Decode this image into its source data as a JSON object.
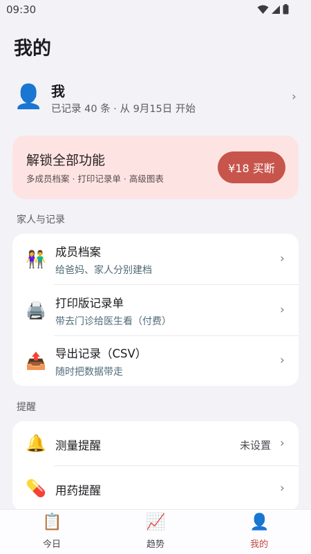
{
  "status_bar": {
    "time": "09:30"
  },
  "page_title": "我的",
  "profile": {
    "name": "我",
    "subtitle": "已记录 40 条 · 从 9月15日 开始"
  },
  "promo": {
    "title": "解锁全部功能",
    "subtitle": "多成员档案 · 打印记录单 · 高级图表",
    "button_label": "¥18 买断",
    "accent_color": "#c7554c"
  },
  "sections": [
    {
      "header": "家人与记录",
      "items": [
        {
          "icon": "family-icon",
          "title": "成员档案",
          "subtitle": "给爸妈、家人分别建档"
        },
        {
          "icon": "printer-icon",
          "title": "打印版记录单",
          "subtitle": "带去门诊给医生看（付费）"
        },
        {
          "icon": "export-icon",
          "title": "导出记录（CSV）",
          "subtitle": "随时把数据带走"
        }
      ]
    },
    {
      "header": "提醒",
      "items": [
        {
          "icon": "bell-icon",
          "title": "测量提醒",
          "value": "未设置"
        },
        {
          "icon": "pill-icon",
          "title": "用药提醒"
        }
      ]
    }
  ],
  "bottom_nav": [
    {
      "icon": "clipboard-icon",
      "label": "今日",
      "active": false
    },
    {
      "icon": "trend-chart-icon",
      "label": "趋势",
      "active": false
    },
    {
      "icon": "person-icon",
      "label": "我的",
      "active": true
    }
  ],
  "active_color": "#c04a44"
}
